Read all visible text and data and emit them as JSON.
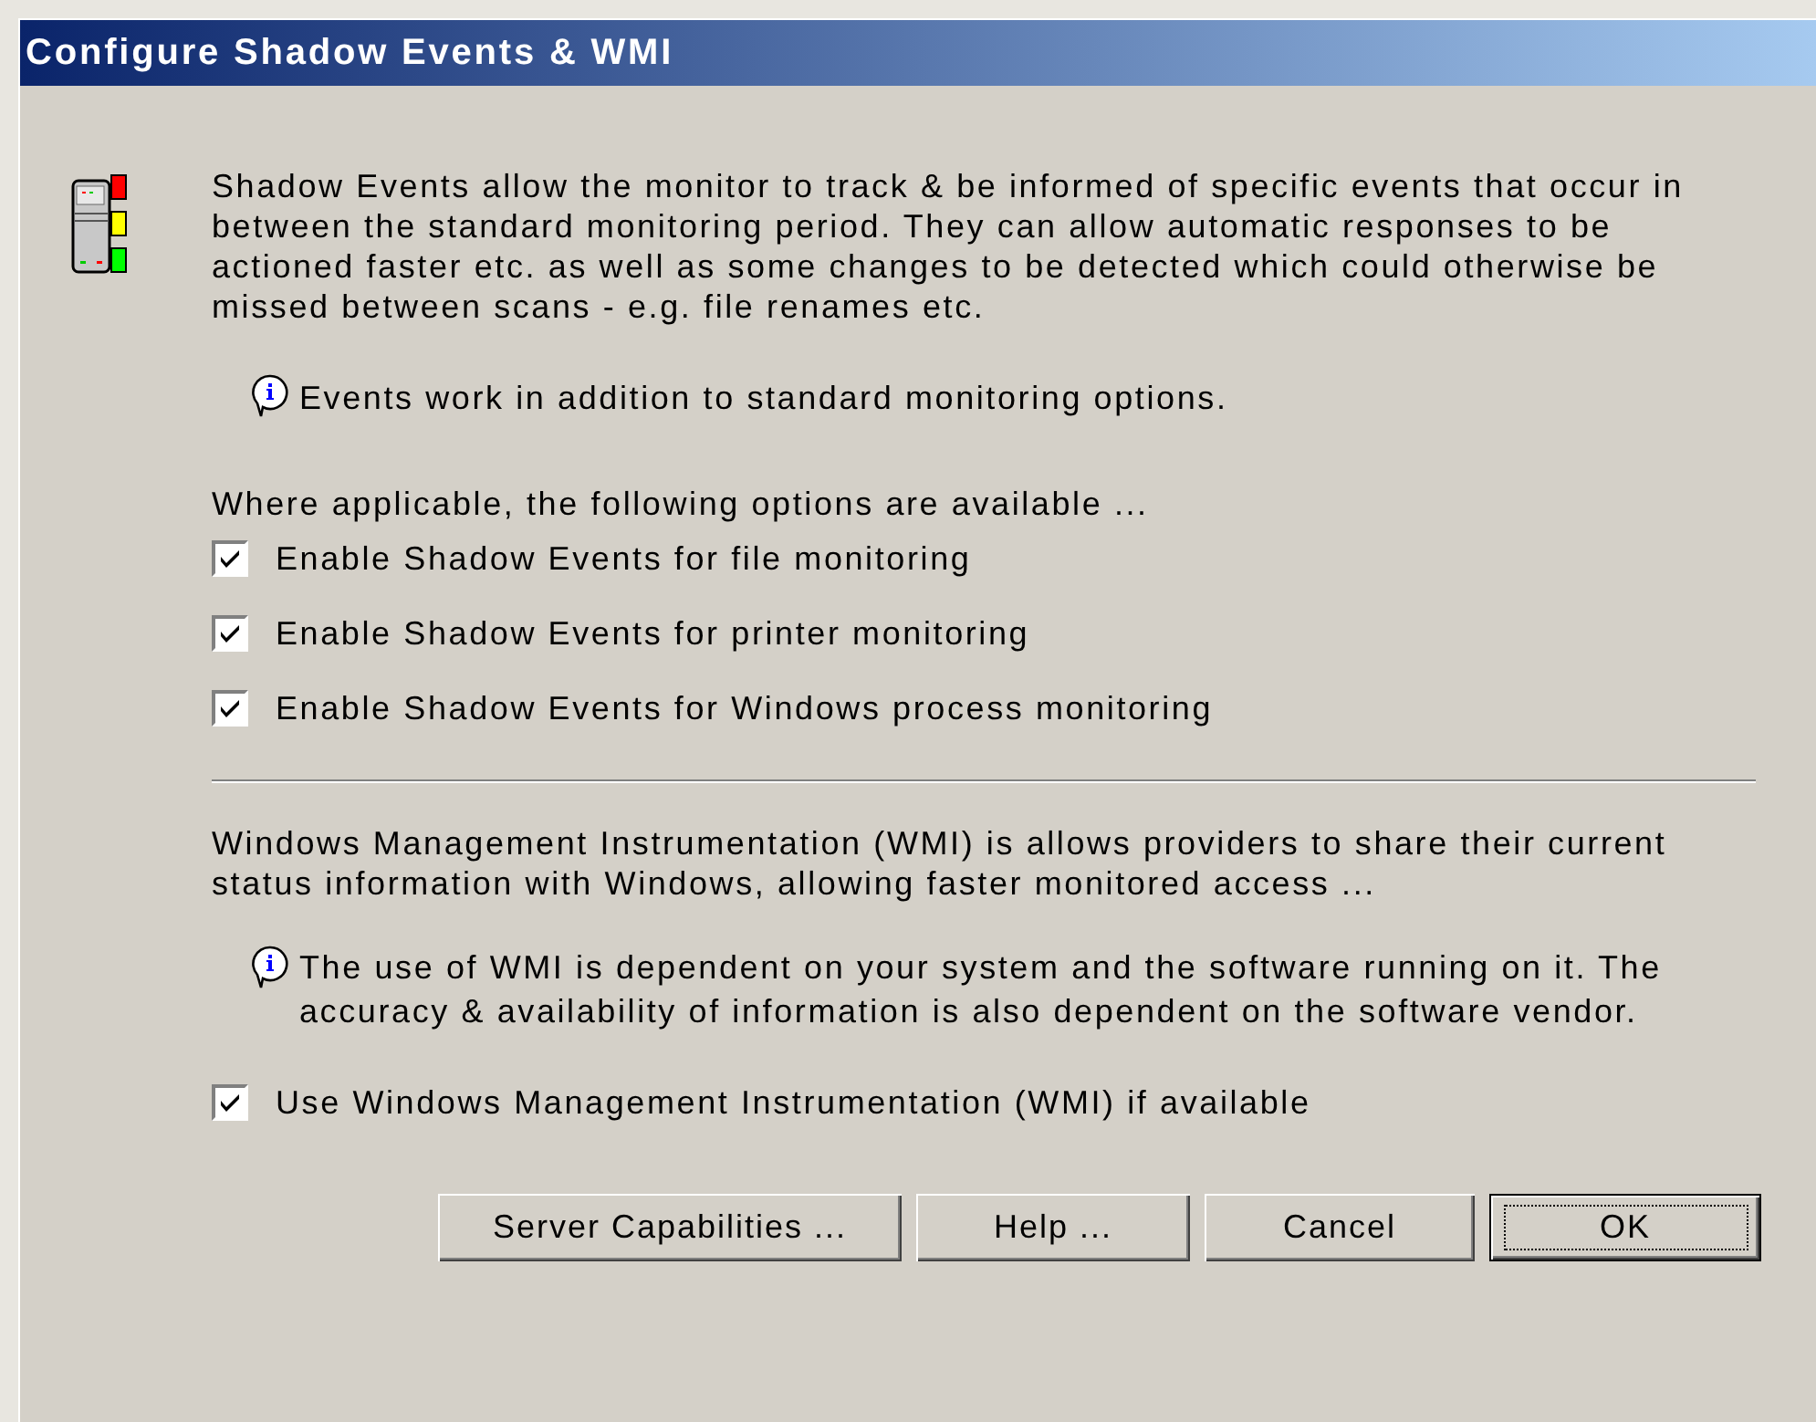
{
  "window": {
    "title": "Configure Shadow Events & WMI"
  },
  "intro": "Shadow Events allow the monitor to track & be informed of specific events that occur in between the standard monitoring period. They can allow automatic responses to be actioned faster etc. as well as some changes to be detected which could otherwise be missed between scans - e.g. file renames etc.",
  "events_note": "Events work in addition to standard monitoring options.",
  "options_heading": "Where applicable, the following options are available ...",
  "event_options": [
    {
      "label": "Enable Shadow Events for file monitoring",
      "checked": true
    },
    {
      "label": "Enable Shadow Events for printer monitoring",
      "checked": true
    },
    {
      "label": "Enable Shadow Events for Windows process monitoring",
      "checked": true
    }
  ],
  "wmi_text": "Windows Management Instrumentation (WMI) is allows providers to share their current status information with Windows, allowing faster monitored access ...",
  "wmi_note": "The use of WMI is dependent on your system and the software running on it. The accuracy & availability of information is also dependent on the software vendor.",
  "wmi_option": {
    "label": "Use Windows Management Instrumentation (WMI) if available",
    "checked": true
  },
  "buttons": [
    {
      "label": "Server Capabilities ...",
      "default": false
    },
    {
      "label": "Help ...",
      "default": false
    },
    {
      "label": "Cancel",
      "default": false
    },
    {
      "label": "OK",
      "default": true
    }
  ]
}
